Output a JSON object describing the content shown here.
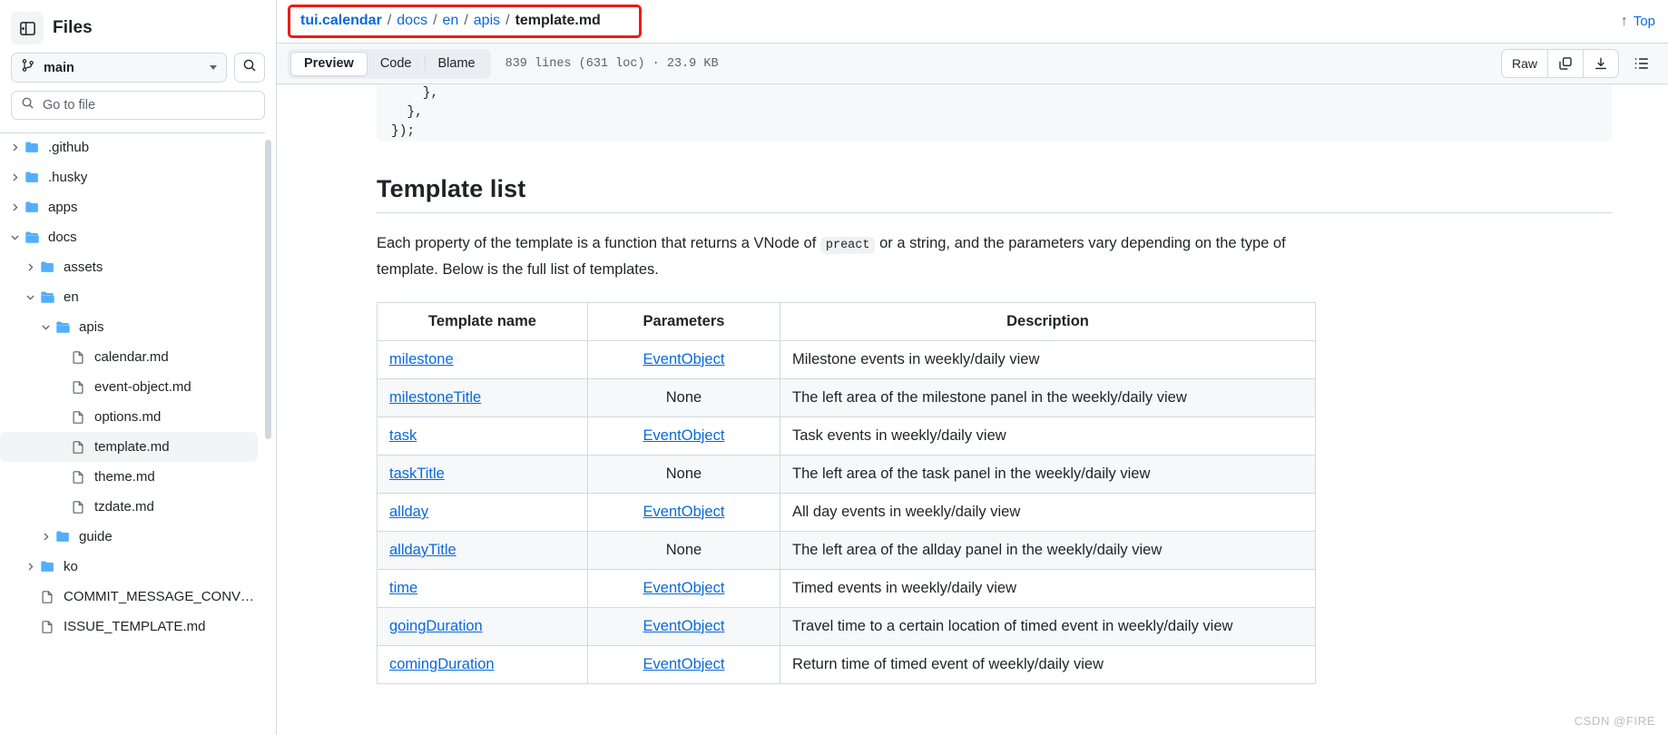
{
  "sidebar": {
    "panel_toggle_icon": "sidebar-collapse-icon",
    "title": "Files",
    "branch": {
      "icon": "git-branch-icon",
      "name": "main",
      "caret_icon": "chevron-down-icon"
    },
    "search_button_icon": "search-icon",
    "go_to_file": {
      "icon": "search-icon",
      "placeholder": "Go to file",
      "value": ""
    },
    "tree": [
      {
        "label": ".github",
        "type": "folder",
        "depth": 0,
        "expanded": false,
        "selected": false
      },
      {
        "label": ".husky",
        "type": "folder",
        "depth": 0,
        "expanded": false,
        "selected": false
      },
      {
        "label": "apps",
        "type": "folder",
        "depth": 0,
        "expanded": false,
        "selected": false
      },
      {
        "label": "docs",
        "type": "folder",
        "depth": 0,
        "expanded": true,
        "selected": false
      },
      {
        "label": "assets",
        "type": "folder",
        "depth": 1,
        "expanded": false,
        "selected": false
      },
      {
        "label": "en",
        "type": "folder",
        "depth": 1,
        "expanded": true,
        "selected": false
      },
      {
        "label": "apis",
        "type": "folder",
        "depth": 2,
        "expanded": true,
        "selected": false
      },
      {
        "label": "calendar.md",
        "type": "file",
        "depth": 3,
        "expanded": null,
        "selected": false
      },
      {
        "label": "event-object.md",
        "type": "file",
        "depth": 3,
        "expanded": null,
        "selected": false
      },
      {
        "label": "options.md",
        "type": "file",
        "depth": 3,
        "expanded": null,
        "selected": false
      },
      {
        "label": "template.md",
        "type": "file",
        "depth": 3,
        "expanded": null,
        "selected": true
      },
      {
        "label": "theme.md",
        "type": "file",
        "depth": 3,
        "expanded": null,
        "selected": false
      },
      {
        "label": "tzdate.md",
        "type": "file",
        "depth": 3,
        "expanded": null,
        "selected": false
      },
      {
        "label": "guide",
        "type": "folder",
        "depth": 2,
        "expanded": false,
        "selected": false
      },
      {
        "label": "ko",
        "type": "folder",
        "depth": 1,
        "expanded": false,
        "selected": false
      },
      {
        "label": "COMMIT_MESSAGE_CONVENT…",
        "type": "file",
        "depth": 1,
        "expanded": null,
        "selected": false
      },
      {
        "label": "ISSUE_TEMPLATE.md",
        "type": "file",
        "depth": 1,
        "expanded": null,
        "selected": false
      }
    ]
  },
  "header": {
    "breadcrumb": {
      "repo": "tui.calendar",
      "parts": [
        "docs",
        "en",
        "apis"
      ],
      "separator": "/",
      "current": "template.md",
      "highlight_color": "#ee1b11"
    },
    "top_link": {
      "icon": "arrow-up-icon",
      "label": "Top"
    }
  },
  "toolbar": {
    "tabs": [
      {
        "label": "Preview",
        "active": true
      },
      {
        "label": "Code",
        "active": false
      },
      {
        "label": "Blame",
        "active": false
      }
    ],
    "file_meta": "839 lines (631 loc) · 23.9 KB",
    "raw_label": "Raw",
    "copy_icon": "copy-icon",
    "download_icon": "download-icon",
    "outline_icon": "list-outline-icon"
  },
  "document": {
    "code_snippet": "    },\n  },\n});",
    "heading": "Template list",
    "paragraph_before": "Each property of the template is a function that returns a VNode of ",
    "paragraph_code": "preact",
    "paragraph_after": " or a string, and the parameters vary depending on the type of template. Below is the full list of templates.",
    "table": {
      "columns": [
        "Template name",
        "Parameters",
        "Description"
      ],
      "rows": [
        {
          "name": "milestone",
          "name_link": true,
          "params": "EventObject",
          "params_link": true,
          "desc": "Milestone events in weekly/daily view"
        },
        {
          "name": "milestoneTitle",
          "name_link": true,
          "params": "None",
          "params_link": false,
          "desc": "The left area of the milestone panel in the weekly/daily view"
        },
        {
          "name": "task",
          "name_link": true,
          "params": "EventObject",
          "params_link": true,
          "desc": "Task events in weekly/daily view"
        },
        {
          "name": "taskTitle",
          "name_link": true,
          "params": "None",
          "params_link": false,
          "desc": "The left area of the task panel in the weekly/daily view"
        },
        {
          "name": "allday",
          "name_link": true,
          "params": "EventObject",
          "params_link": true,
          "desc": "All day events in weekly/daily view"
        },
        {
          "name": "alldayTitle",
          "name_link": true,
          "params": "None",
          "params_link": false,
          "desc": "The left area of the allday panel in the weekly/daily view"
        },
        {
          "name": "time",
          "name_link": true,
          "params": "EventObject",
          "params_link": true,
          "desc": "Timed events in weekly/daily view"
        },
        {
          "name": "goingDuration",
          "name_link": true,
          "params": "EventObject",
          "params_link": true,
          "desc": "Travel time to a certain location of timed event in weekly/daily view"
        },
        {
          "name": "comingDuration",
          "name_link": true,
          "params": "EventObject",
          "params_link": true,
          "desc": "Return time of timed event of weekly/daily view"
        }
      ]
    }
  },
  "watermark": "CSDN @FIRE",
  "colors": {
    "link": "#0969da",
    "border": "#d1d9e0",
    "alt_row": "#f6f8fa",
    "folder": "#54aeff"
  }
}
